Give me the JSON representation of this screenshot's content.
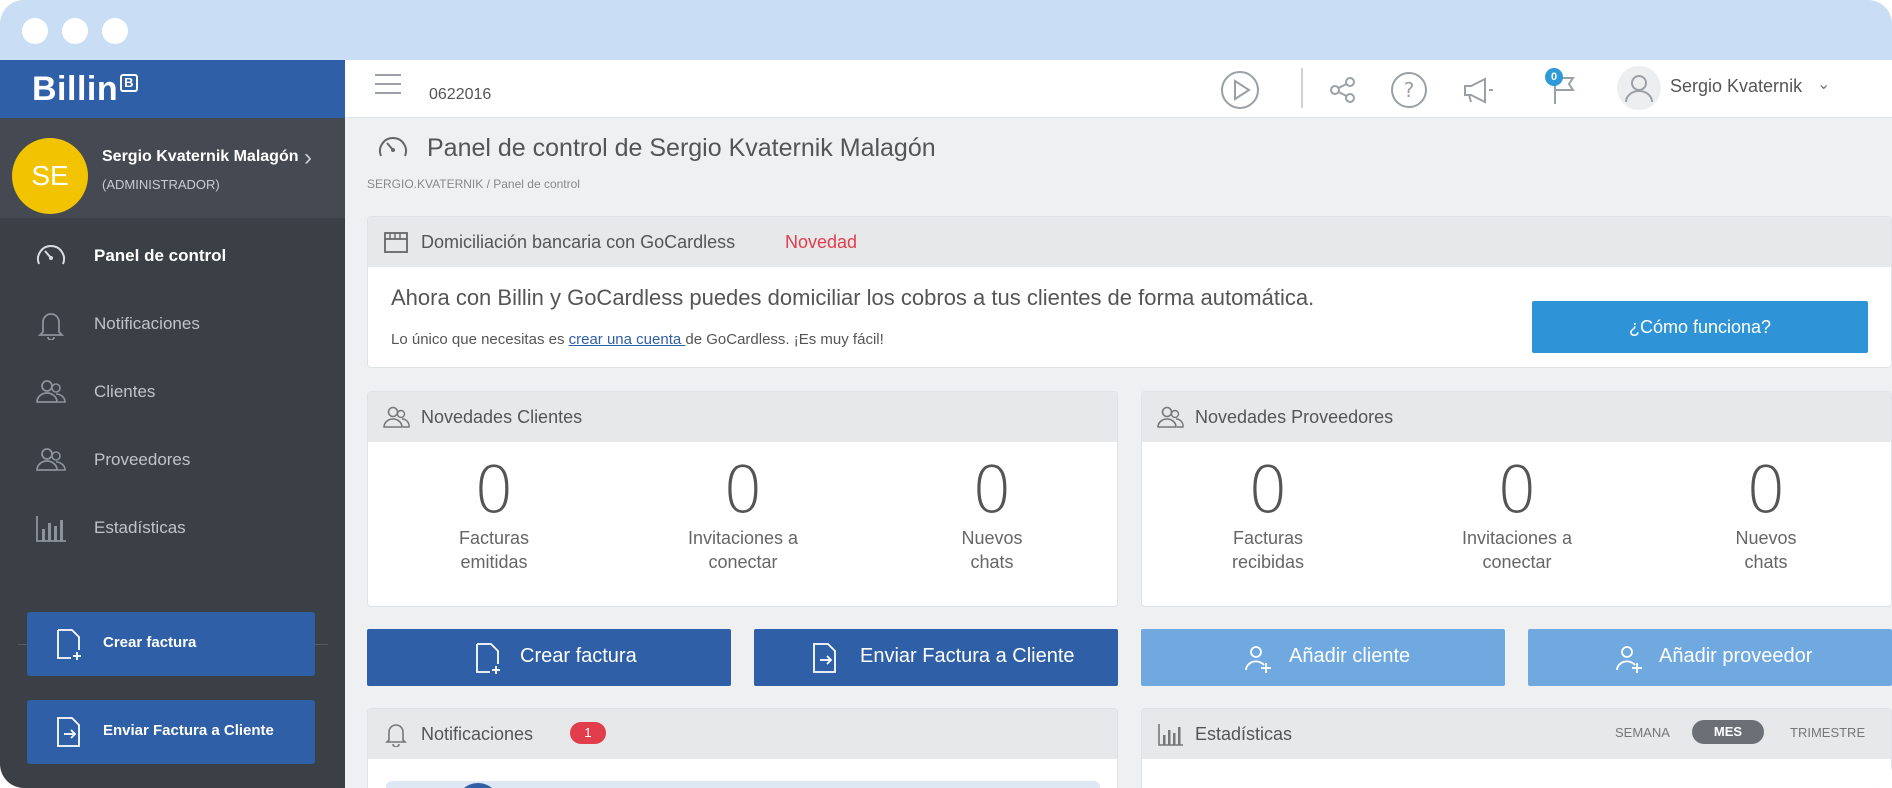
{
  "window": {
    "controls": [
      "close",
      "minimize",
      "maximize"
    ]
  },
  "sidebar": {
    "logo": "Billin",
    "logo_badge": "B",
    "user": {
      "initials": "SE",
      "name": "Sergio Kvaternik Malagón",
      "role": "(ADMINISTRADOR)"
    },
    "items": [
      {
        "label": "Panel de control",
        "icon": "dashboard-gauge-icon",
        "active": true
      },
      {
        "label": "Notificaciones",
        "icon": "bell-icon",
        "active": false
      },
      {
        "label": "Clientes",
        "icon": "users-icon",
        "active": false
      },
      {
        "label": "Proveedores",
        "icon": "users-icon",
        "active": false
      },
      {
        "label": "Estadísticas",
        "icon": "bar-chart-icon",
        "active": false
      }
    ],
    "buttons": [
      {
        "label": "Crear factura",
        "icon": "new-document-icon"
      },
      {
        "label": "Enviar Factura a Cliente",
        "icon": "send-document-icon"
      }
    ]
  },
  "topbar": {
    "company_id": "0622016",
    "flag_count": "0",
    "username": "Sergio Kvaternik"
  },
  "main": {
    "title": "Panel de control de Sergio Kvaternik Malagón",
    "breadcrumb": "SERGIO.KVATERNIK  /  Panel de control",
    "gocardless": {
      "title": "Domiciliación bancaria con GoCardless",
      "badge": "Novedad",
      "text": "Ahora con Billin y GoCardless puedes domiciliar los cobros a tus clientes de forma automática.",
      "sub_before": "Lo único que necesitas es ",
      "sub_link": "crear una cuenta ",
      "sub_after": " de GoCardless. ¡Es muy fácil!",
      "button": "¿Cómo funciona?"
    },
    "clients_panel": {
      "title": "Novedades Clientes",
      "stats": [
        {
          "value": "0",
          "line1": "Facturas",
          "line2": "emitidas"
        },
        {
          "value": "0",
          "line1": "Invitaciones a",
          "line2": "conectar"
        },
        {
          "value": "0",
          "line1": "Nuevos",
          "line2": "chats"
        }
      ]
    },
    "providers_panel": {
      "title": "Novedades Proveedores",
      "stats": [
        {
          "value": "0",
          "line1": "Facturas",
          "line2": "recibidas"
        },
        {
          "value": "0",
          "line1": "Invitaciones a",
          "line2": "conectar"
        },
        {
          "value": "0",
          "line1": "Nuevos",
          "line2": "chats"
        }
      ]
    },
    "actions": [
      {
        "label": "Crear factura",
        "icon": "new-document-icon"
      },
      {
        "label": "Enviar Factura a Cliente",
        "icon": "send-document-icon"
      },
      {
        "label": "Añadir cliente",
        "icon": "add-user-icon"
      },
      {
        "label": "Añadir proveedor",
        "icon": "add-user-icon"
      }
    ],
    "notifications_panel": {
      "title": "Notificaciones",
      "badge": "1"
    },
    "stats_panel": {
      "title": "Estadísticas",
      "periods": [
        "SEMANA",
        "MES",
        "TRIMESTRE"
      ],
      "selected_period": "MES"
    }
  }
}
